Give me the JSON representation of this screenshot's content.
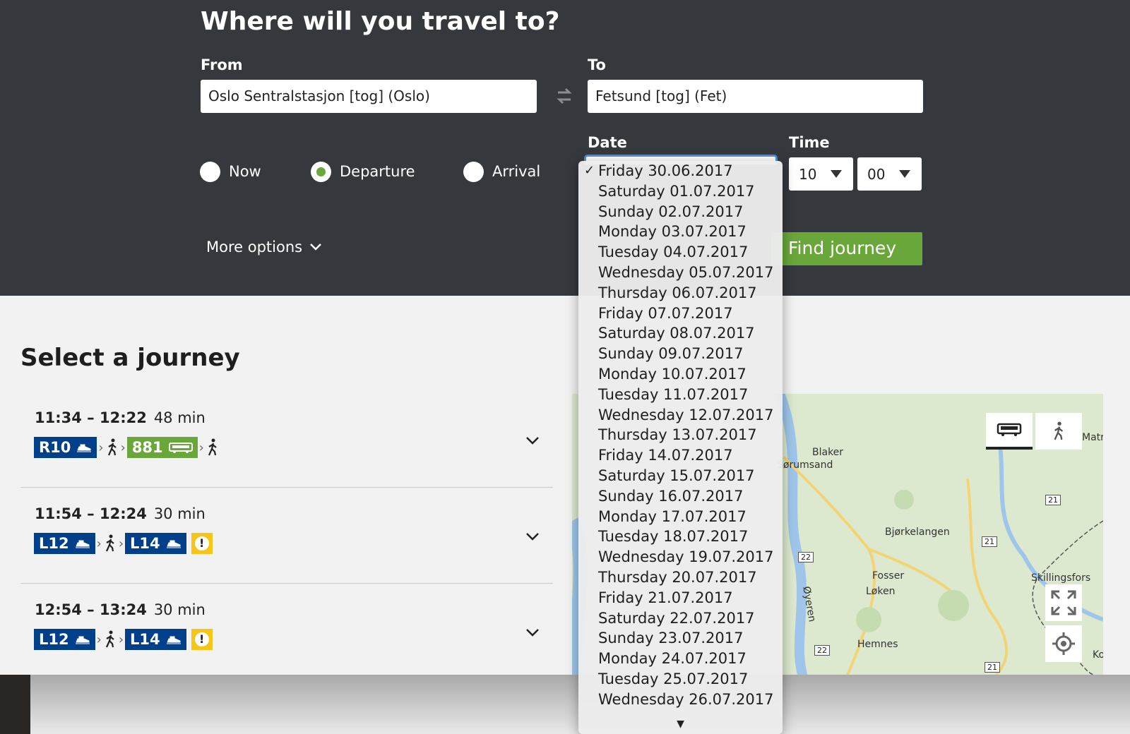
{
  "search": {
    "title": "Where will you travel to?",
    "from_label": "From",
    "from_value": "Oslo Sentralstasjon [tog] (Oslo)",
    "to_label": "To",
    "to_value": "Fetsund [tog] (Fet)",
    "date_label": "Date",
    "time_label": "Time",
    "hour": "10",
    "minute": "00",
    "mode_now": "Now",
    "mode_departure": "Departure",
    "mode_arrival": "Arrival",
    "selected_mode": "Departure",
    "more_options": "More options",
    "find_button": "Find journey"
  },
  "date_dropdown": {
    "selected": "Friday 30.06.2017",
    "options": [
      "Friday 30.06.2017",
      "Saturday 01.07.2017",
      "Sunday 02.07.2017",
      "Monday 03.07.2017",
      "Tuesday 04.07.2017",
      "Wednesday 05.07.2017",
      "Thursday 06.07.2017",
      "Friday 07.07.2017",
      "Saturday 08.07.2017",
      "Sunday 09.07.2017",
      "Monday 10.07.2017",
      "Tuesday 11.07.2017",
      "Wednesday 12.07.2017",
      "Thursday 13.07.2017",
      "Friday 14.07.2017",
      "Saturday 15.07.2017",
      "Sunday 16.07.2017",
      "Monday 17.07.2017",
      "Tuesday 18.07.2017",
      "Wednesday 19.07.2017",
      "Thursday 20.07.2017",
      "Friday 21.07.2017",
      "Saturday 22.07.2017",
      "Sunday 23.07.2017",
      "Monday 24.07.2017",
      "Tuesday 25.07.2017",
      "Wednesday 26.07.2017"
    ],
    "check_mark": "✓",
    "scroll_arrow": "▼"
  },
  "results": {
    "title": "Select a journey",
    "journeys": [
      {
        "time": "11:34 – 12:22",
        "duration": "48 min",
        "legs": [
          {
            "type": "train",
            "line": "R10"
          },
          {
            "type": "walk"
          },
          {
            "type": "bus",
            "line": "881"
          },
          {
            "type": "walk"
          }
        ]
      },
      {
        "time": "11:54 – 12:24",
        "duration": "30 min",
        "legs": [
          {
            "type": "train",
            "line": "L12"
          },
          {
            "type": "walk"
          },
          {
            "type": "train",
            "line": "L14"
          },
          {
            "type": "warning",
            "symbol": "!"
          }
        ]
      },
      {
        "time": "12:54 – 13:24",
        "duration": "30 min",
        "legs": [
          {
            "type": "train",
            "line": "L12"
          },
          {
            "type": "walk"
          },
          {
            "type": "train",
            "line": "L14"
          },
          {
            "type": "warning",
            "symbol": "!"
          }
        ]
      }
    ]
  },
  "map": {
    "places": [
      "Blaker",
      "Sørumsand",
      "Bjørkelangen",
      "Fosser",
      "Løken",
      "Skillingsfors",
      "Hemnes",
      "Øyeren",
      "Matr",
      "Ko"
    ],
    "road_numbers": [
      "21",
      "21",
      "22",
      "22",
      "21"
    ],
    "controls": [
      "bus-icon",
      "walk-icon",
      "fullscreen-icon",
      "locate-icon"
    ]
  },
  "colors": {
    "header_bg": "#35383c",
    "accent_green": "#6aa73a",
    "train_blue": "#003f8a",
    "warning_yellow": "#f5c518",
    "focus_blue": "#4a90e2"
  }
}
